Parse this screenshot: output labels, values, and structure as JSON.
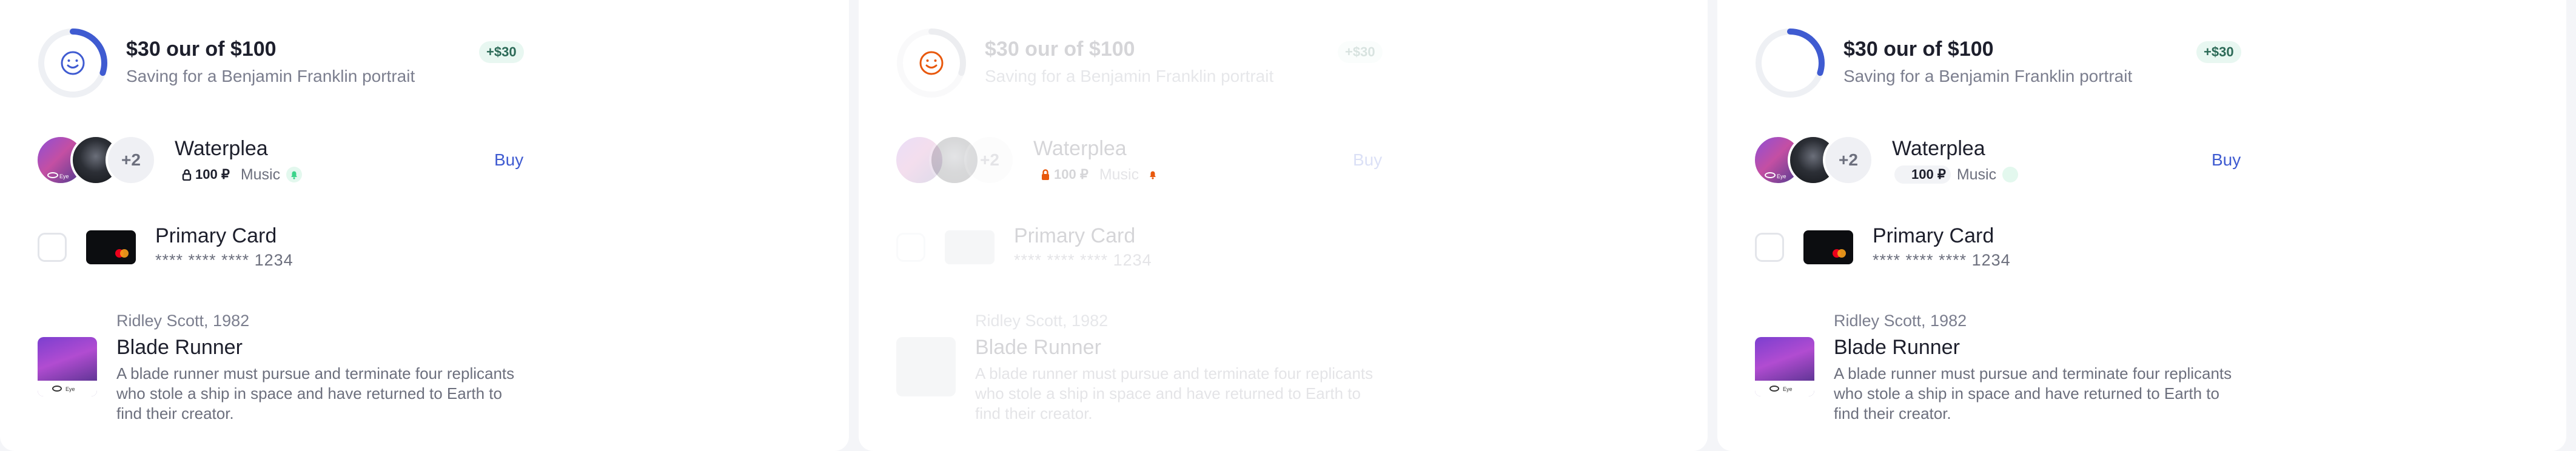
{
  "colors": {
    "accent": "#3f5bd1",
    "progress_track": "#eef0f4",
    "badge_bg": "#e8f7f1",
    "warning": "#e8580c",
    "bell_green": "#3bd48a"
  },
  "panels": [
    {
      "state": "default",
      "progress": {
        "icon": "smiley-icon",
        "fraction": 0.3,
        "title": "$30 our of $100",
        "subtitle": "Saving for a Benjamin Franklin portrait",
        "badge": "+$30"
      },
      "artist": {
        "more_count": "+2",
        "title": "Waterplea",
        "price": "100 ₽",
        "genre": "Music",
        "buy_label": "Buy"
      },
      "card": {
        "title": "Primary Card",
        "number": "**** **** **** 1234"
      },
      "movie": {
        "meta": "Ridley Scott, 1982",
        "title": "Blade Runner",
        "description": "A blade runner must pursue and terminate four replicants who stole a ship in space and have returned to Earth to find their creator."
      }
    },
    {
      "state": "disabled",
      "progress": {
        "icon": "smiley-icon",
        "fraction": 0.3,
        "title": "$30 our of $100",
        "subtitle": "Saving for a Benjamin Franklin portrait",
        "badge": "+$30"
      },
      "artist": {
        "more_count": "+2",
        "title": "Waterplea",
        "price": "100 ₽",
        "genre": "Music",
        "buy_label": "Buy"
      },
      "card": {
        "title": "Primary Card",
        "number": "**** **** **** 1234"
      },
      "movie": {
        "meta": "Ridley Scott, 1982",
        "title": "Blade Runner",
        "description": "A blade runner must pursue and terminate four replicants who stole a ship in space and have returned to Earth to find their creator."
      }
    },
    {
      "state": "default",
      "progress": {
        "fraction": 0.3,
        "title": "$30 our of $100",
        "subtitle": "Saving for a Benjamin Franklin portrait",
        "badge": "+$30"
      },
      "artist": {
        "more_count": "+2",
        "title": "Waterplea",
        "price": "100 ₽",
        "genre": "Music",
        "buy_label": "Buy"
      },
      "card": {
        "title": "Primary Card",
        "number": "**** **** **** 1234"
      },
      "movie": {
        "meta": "Ridley Scott, 1982",
        "title": "Blade Runner",
        "description": "A blade runner must pursue and terminate four replicants who stole a ship in space and have returned to Earth to find their creator."
      }
    }
  ]
}
